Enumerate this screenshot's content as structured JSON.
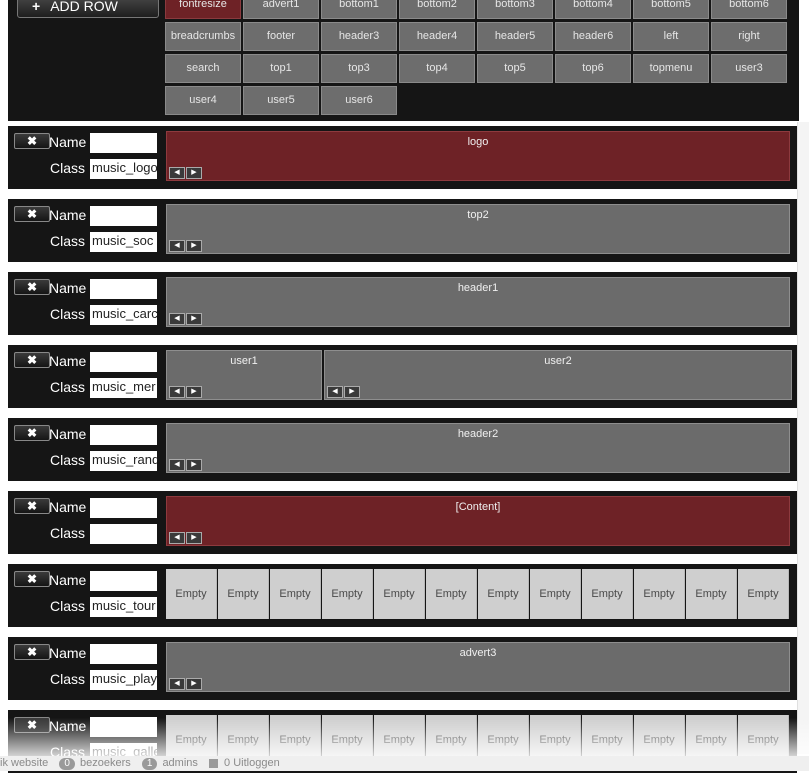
{
  "toolbar": {
    "add_row_label": "ADD ROW"
  },
  "positions": [
    "fontresize",
    "advert1",
    "bottom1",
    "bottom2",
    "bottom3",
    "bottom4",
    "bottom5",
    "bottom6",
    "breadcrumbs",
    "footer",
    "header3",
    "header4",
    "header5",
    "header6",
    "left",
    "right",
    "search",
    "top1",
    "top3",
    "top4",
    "top5",
    "top6",
    "topmenu",
    "user3",
    "user4",
    "user5",
    "user6"
  ],
  "active_position": "fontresize",
  "labels": {
    "name": "Name",
    "class": "Class",
    "empty": "Empty"
  },
  "rows": [
    {
      "class_value": "music_logo",
      "blocks": [
        {
          "title": "logo",
          "color": "red"
        }
      ]
    },
    {
      "class_value": "music_soc",
      "blocks": [
        {
          "title": "top2",
          "color": "gray"
        }
      ]
    },
    {
      "class_value": "music_carc",
      "blocks": [
        {
          "title": "header1",
          "color": "gray"
        }
      ]
    },
    {
      "class_value": "music_mer",
      "blocks": [
        {
          "title": "user1",
          "color": "gray"
        },
        {
          "title": "user2",
          "color": "gray"
        }
      ]
    },
    {
      "class_value": "music_rand",
      "blocks": [
        {
          "title": "header2",
          "color": "gray"
        }
      ]
    },
    {
      "class_value": "",
      "blocks": [
        {
          "title": "[Content]",
          "color": "red"
        }
      ]
    },
    {
      "class_value": "music_tour",
      "empty_cells": 12
    },
    {
      "class_value": "music_play",
      "blocks": [
        {
          "title": "advert3",
          "color": "gray"
        }
      ]
    },
    {
      "class_value": "music_galle",
      "empty_cells": 12
    }
  ],
  "footer": {
    "site_text": "ik website",
    "visitors_count": "0",
    "visitors_label": "bezoekers",
    "admins_count": "1",
    "admins_label": "admins",
    "logout_text": "0  Uitloggen"
  },
  "colors": {
    "active": "#6e2226",
    "block": "#6b6b6b",
    "panel": "#151515",
    "empty": "#cfcfcf"
  }
}
